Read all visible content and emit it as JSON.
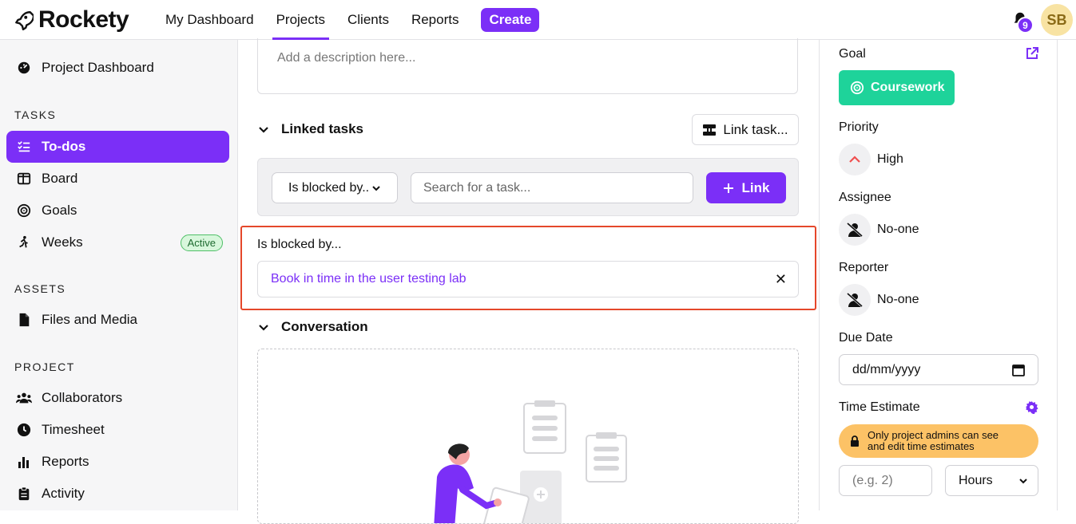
{
  "app": {
    "name": "Rockety"
  },
  "nav": {
    "items": [
      "My Dashboard",
      "Projects",
      "Clients",
      "Reports"
    ],
    "active": "Projects",
    "create_label": "Create",
    "notifications_count": "9",
    "avatar_initials": "SB"
  },
  "sidebar": {
    "project_dashboard": "Project Dashboard",
    "tasks_heading": "TASKS",
    "tasks": [
      "To-dos",
      "Board",
      "Goals",
      "Weeks"
    ],
    "weeks_badge": "Active",
    "assets_heading": "ASSETS",
    "assets": [
      "Files and Media"
    ],
    "project_heading": "PROJECT",
    "project": [
      "Collaborators",
      "Timesheet",
      "Reports",
      "Activity"
    ]
  },
  "main": {
    "description_placeholder": "Add a description here...",
    "linked_tasks_title": "Linked tasks",
    "link_task_button": "Link task...",
    "relation_select": "Is blocked by..",
    "search_placeholder": "Search for a task...",
    "link_button": "Link",
    "blocked_by_label": "Is blocked by...",
    "blocked_items": [
      "Book in time in the user testing lab"
    ],
    "conversation_title": "Conversation"
  },
  "details": {
    "goal_label": "Goal",
    "goal_value": "Coursework",
    "priority_label": "Priority",
    "priority_value": "High",
    "assignee_label": "Assignee",
    "assignee_value": "No-one",
    "reporter_label": "Reporter",
    "reporter_value": "No-one",
    "due_date_label": "Due Date",
    "due_date_placeholder": "dd/mm/yyyy",
    "time_estimate_label": "Time Estimate",
    "warning_line1": "Only project admins can see",
    "warning_line2": "and edit time estimates",
    "estimate_placeholder": "(e.g. 2)",
    "estimate_unit": "Hours"
  },
  "colors": {
    "accent": "#7b2ff7",
    "goal": "#1ed39a",
    "warning": "#fcc266",
    "highlight": "#e5472a"
  }
}
